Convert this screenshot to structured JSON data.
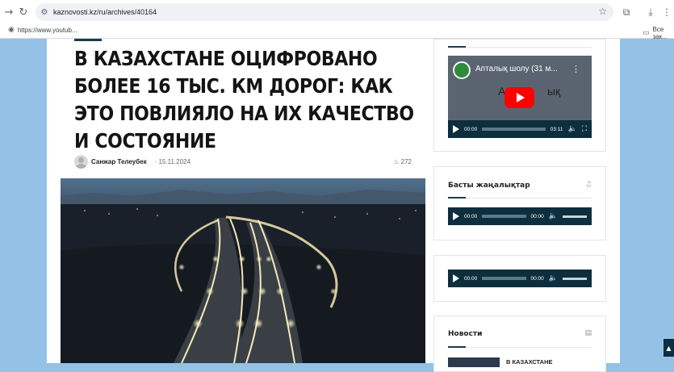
{
  "browser": {
    "url": "kaznovosti.kz/ru/archives/40164",
    "bookmarks": [
      {
        "label": "https://www.youtub..."
      },
      {
        "label": "Все зак..."
      }
    ]
  },
  "article": {
    "title": "В Казахстане оцифровано более 16 тыс. км дорог: как это повлияло на их качество и состояние",
    "author": "Санжар Телеубек",
    "date": "15.11.2024",
    "views": "272"
  },
  "sidebar": {
    "video": {
      "title": "Апталық шолу (31 м...",
      "overlay": "Ап",
      "overlay_tail": "ық",
      "time_current": "00:00",
      "time_total": "03:11"
    },
    "radio": {
      "title": "Басты жаңалықтар",
      "time_current": "00:00",
      "time_total": "00:00"
    },
    "audio2": {
      "time_current": "00:00",
      "time_total": "00:00"
    },
    "news": {
      "title": "Новости",
      "first_item": "В Казахстане"
    }
  },
  "colors": {
    "page_bg": "#93c2e6",
    "accent": "#1f3a4d",
    "player_bg": "#0c2e3d",
    "youtube_red": "#ff0000"
  }
}
